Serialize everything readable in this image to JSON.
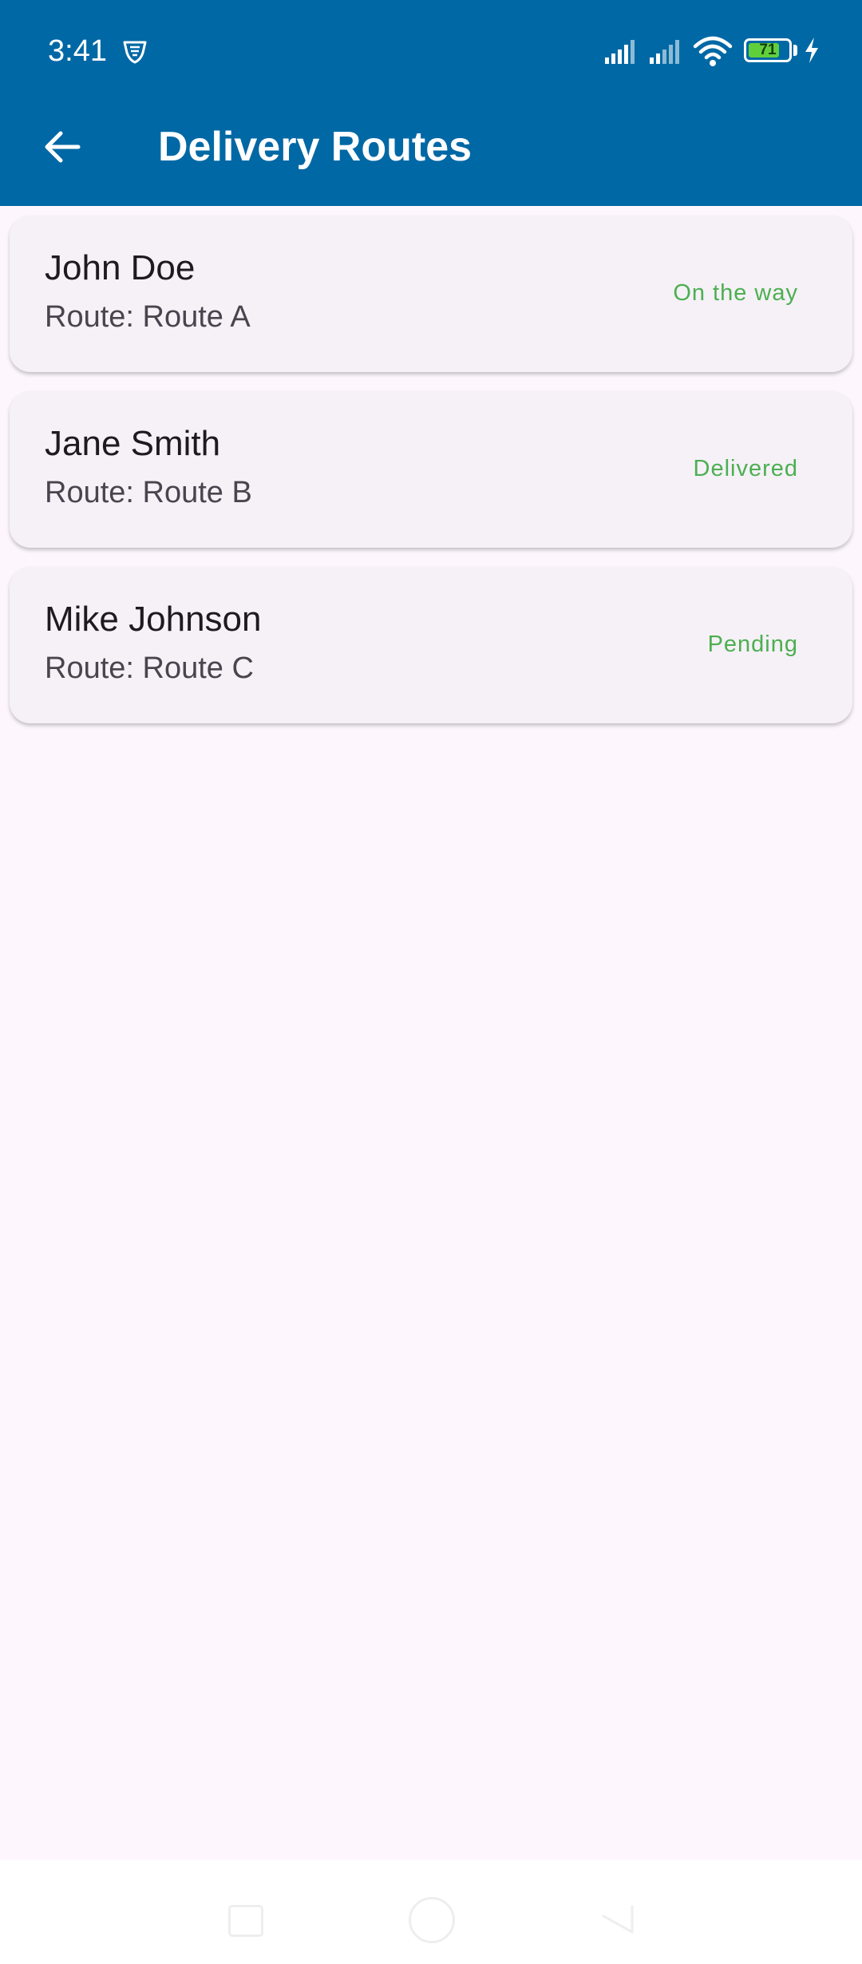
{
  "status_bar": {
    "time": "3:41",
    "battery_level": "71",
    "icons": [
      "vpn-shield-icon",
      "cell-signal-icon",
      "cell-signal-icon",
      "wifi-icon",
      "battery-icon",
      "charging-bolt-icon"
    ],
    "battery_color": "#5fd03a"
  },
  "app_bar": {
    "title": "Delivery Routes",
    "back_icon": "arrow-left-icon",
    "background": "#0068a5"
  },
  "routes": [
    {
      "name": "John Doe",
      "route": "Route: Route A",
      "status": "On the way"
    },
    {
      "name": "Jane Smith",
      "route": "Route: Route B",
      "status": "Delivered"
    },
    {
      "name": "Mike Johnson",
      "route": "Route: Route C",
      "status": "Pending"
    }
  ],
  "colors": {
    "status_text": "#4caf50",
    "card_background": "#f5f1f7",
    "page_background": "#fdf7fd"
  },
  "nav_bar": {
    "icons": [
      "recents-square-icon",
      "home-circle-icon",
      "back-triangle-icon"
    ]
  }
}
